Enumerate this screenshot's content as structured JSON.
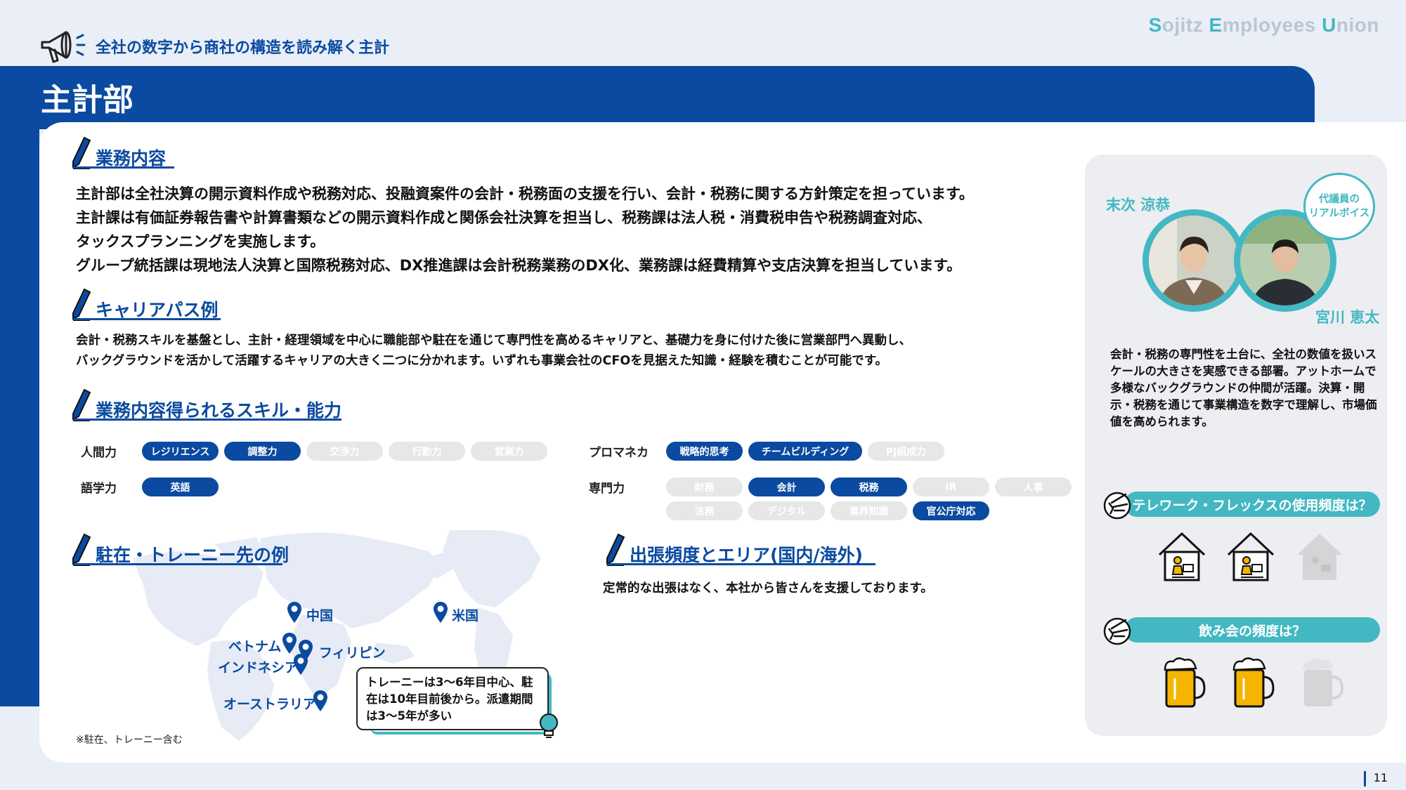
{
  "brand": {
    "s": "S",
    "ojitz": "ojitz ",
    "e": "E",
    "mployees": "mployees ",
    "u": "U",
    "nion": "nion"
  },
  "header": {
    "tagline": "全社の数字から商社の構造を読み解く主計",
    "title": "主計部"
  },
  "sections": {
    "business": {
      "heading": "業務内容",
      "lines": [
        "主計部は全社決算の開示資料作成や税務対応、投融資案件の会計・税務面の支援を行い、会計・税務に関する方針策定を担っています。",
        "主計課は有価証券報告書や計算書類などの開示資料作成と関係会社決算を担当し、税務課は法人税・消費税申告や税務調査対応、",
        "タックスプランニングを実施します。",
        "グループ統括課は現地法人決算と国際税務対応、DX推進課は会計税務業務のDX化、業務課は経費精算や支店決算を担当しています。"
      ]
    },
    "career": {
      "heading": "キャリアパス例",
      "lines": [
        "会計・税務スキルを基盤とし、主計・経理領域を中心に職能部や駐在を通じて専門性を高めるキャリアと、基礎力を身に付けた後に営業部門へ異動し、",
        "バックグラウンドを活かして活躍するキャリアの大きく二つに分かれます。いずれも事業会社のCFOを見据えた知識・経験を積むことが可能です。"
      ]
    },
    "skills": {
      "heading": "業務内容得られるスキル・能力",
      "groups": [
        {
          "label": "人間力",
          "pills": [
            {
              "text": "レジリエンス",
              "on": true
            },
            {
              "text": "調整力",
              "on": true
            },
            {
              "text": "交渉力",
              "on": false
            },
            {
              "text": "行動力",
              "on": false
            },
            {
              "text": "営業力",
              "on": false
            }
          ]
        },
        {
          "label": "語学力",
          "pills": [
            {
              "text": "英語",
              "on": true
            }
          ]
        },
        {
          "label": "プロマネカ",
          "pills": [
            {
              "text": "戦略的思考",
              "on": true
            },
            {
              "text": "チームビルディング",
              "on": true
            },
            {
              "text": "PJ組成力",
              "on": false
            }
          ]
        },
        {
          "label": "専門力",
          "pills": [
            {
              "text": "財務",
              "on": false
            },
            {
              "text": "会計",
              "on": true
            },
            {
              "text": "税務",
              "on": true
            },
            {
              "text": "IR",
              "on": false
            },
            {
              "text": "人事",
              "on": false
            },
            {
              "text": "法務",
              "on": false
            },
            {
              "text": "デジタル",
              "on": false
            },
            {
              "text": "業界知識",
              "on": false
            },
            {
              "text": "官公庁対応",
              "on": true
            }
          ]
        }
      ]
    },
    "overseas": {
      "heading": "駐在・トレーニー先の例",
      "cities": [
        "中国",
        "米国",
        "ベトナム",
        "フィリピン",
        "インドネシア",
        "オーストラリア"
      ],
      "trainee_note": "トレーニーは3～6年目中心、駐在は10年目前後から。派遣期間は3～5年が多い",
      "footnote": "※駐在、トレーニー含む"
    },
    "travel": {
      "heading": "出張頻度とエリア(国内/海外)",
      "text": "定常的な出張はなく、本社から皆さんを支援しております。"
    }
  },
  "right_panel": {
    "person1": "末次 涼恭",
    "person2": "宮川 恵太",
    "voice_label_1": "代議員の",
    "voice_label_2": "リアルボイス",
    "comment": "会計・税務の専門性を土台に、全社の数値を扱いスケールの大きさを実感できる部署。アットホームで多様なバックグラウンドの仲間が活躍。決算・開示・税務を通じて事業構造を数字で理解し、市場価値を高められます。",
    "q_telework": "テレワーク・フレックスの使用頻度は？",
    "telework_level": 2,
    "telework_max": 3,
    "q_drinking": "飲み会の頻度は？",
    "drinking_level": 2,
    "drinking_max": 3
  },
  "colors": {
    "navy": "#0a4aa0",
    "teal": "#43b8c2",
    "gold": "#f5b400"
  },
  "footer": {
    "page": "11"
  }
}
